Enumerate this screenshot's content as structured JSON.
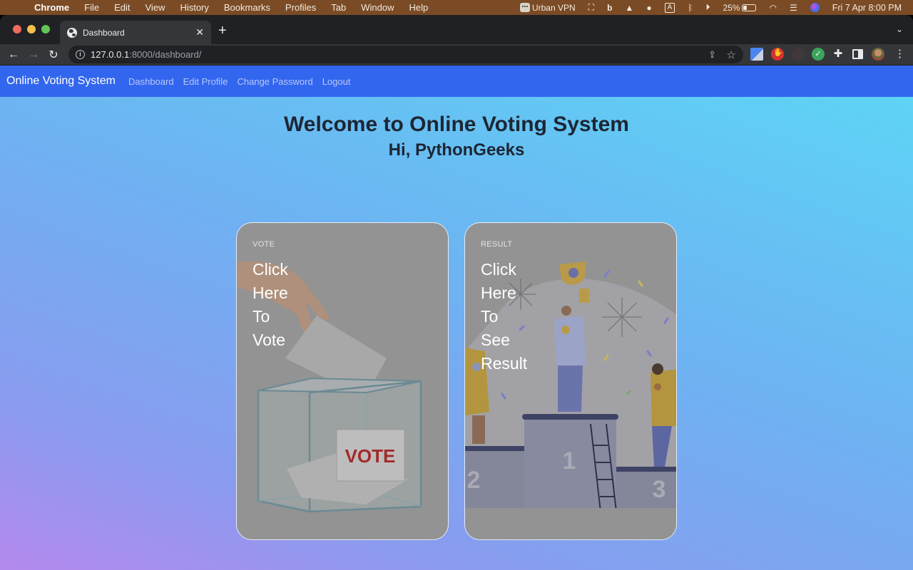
{
  "menubar": {
    "app_name": "Chrome",
    "items": [
      "File",
      "Edit",
      "View",
      "History",
      "Bookmarks",
      "Profiles",
      "Tab",
      "Window",
      "Help"
    ],
    "status": {
      "vpn_label": "Urban VPN",
      "input_source": "A",
      "battery_percent": "25%",
      "datetime": "Fri 7 Apr  8:00 PM"
    }
  },
  "browser": {
    "tab_title": "Dashboard",
    "url_host": "127.0.0.1",
    "url_path": ":8000/dashboard/"
  },
  "navbar": {
    "brand": "Online Voting System",
    "links": [
      "Dashboard",
      "Edit Profile",
      "Change Password",
      "Logout"
    ]
  },
  "main": {
    "welcome": "Welcome to Online Voting System",
    "greeting": "Hi, PythonGeeks",
    "cards": [
      {
        "label": "VOTE",
        "title_lines": [
          "Click",
          "Here",
          "To",
          "Vote"
        ],
        "image_caption": "VOTE"
      },
      {
        "label": "RESULT",
        "title_lines": [
          "Click",
          "Here",
          "To",
          "See",
          "Result"
        ],
        "podium_numbers": [
          "1",
          "2",
          "3"
        ]
      }
    ]
  },
  "colors": {
    "navbar_bg": "#3366ee",
    "menubar_bg": "#7a4b25",
    "card_overlay": "#939393",
    "vote_text": "#a32a2a"
  }
}
